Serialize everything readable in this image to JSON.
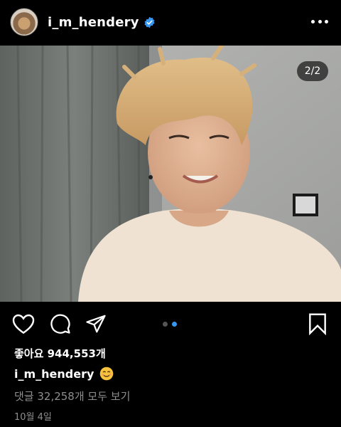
{
  "header": {
    "username": "i_m_hendery",
    "verified_icon": "verified-badge-icon",
    "menu_icon": "more-options-icon",
    "accent": "#3897f0"
  },
  "post": {
    "image_counter": "2/2",
    "carousel_total": 2,
    "carousel_active_index": 2
  },
  "actions": {
    "like_icon": "heart-icon",
    "comment_icon": "comment-icon",
    "share_icon": "share-icon",
    "save_icon": "bookmark-icon"
  },
  "footer": {
    "likes": "좋아요 944,553개",
    "caption_user": "i_m_hendery",
    "caption_emoji": "smiling-face-emoji",
    "view_comments": "댓글 32,258개 모두 보기",
    "date": "10월 4일"
  }
}
